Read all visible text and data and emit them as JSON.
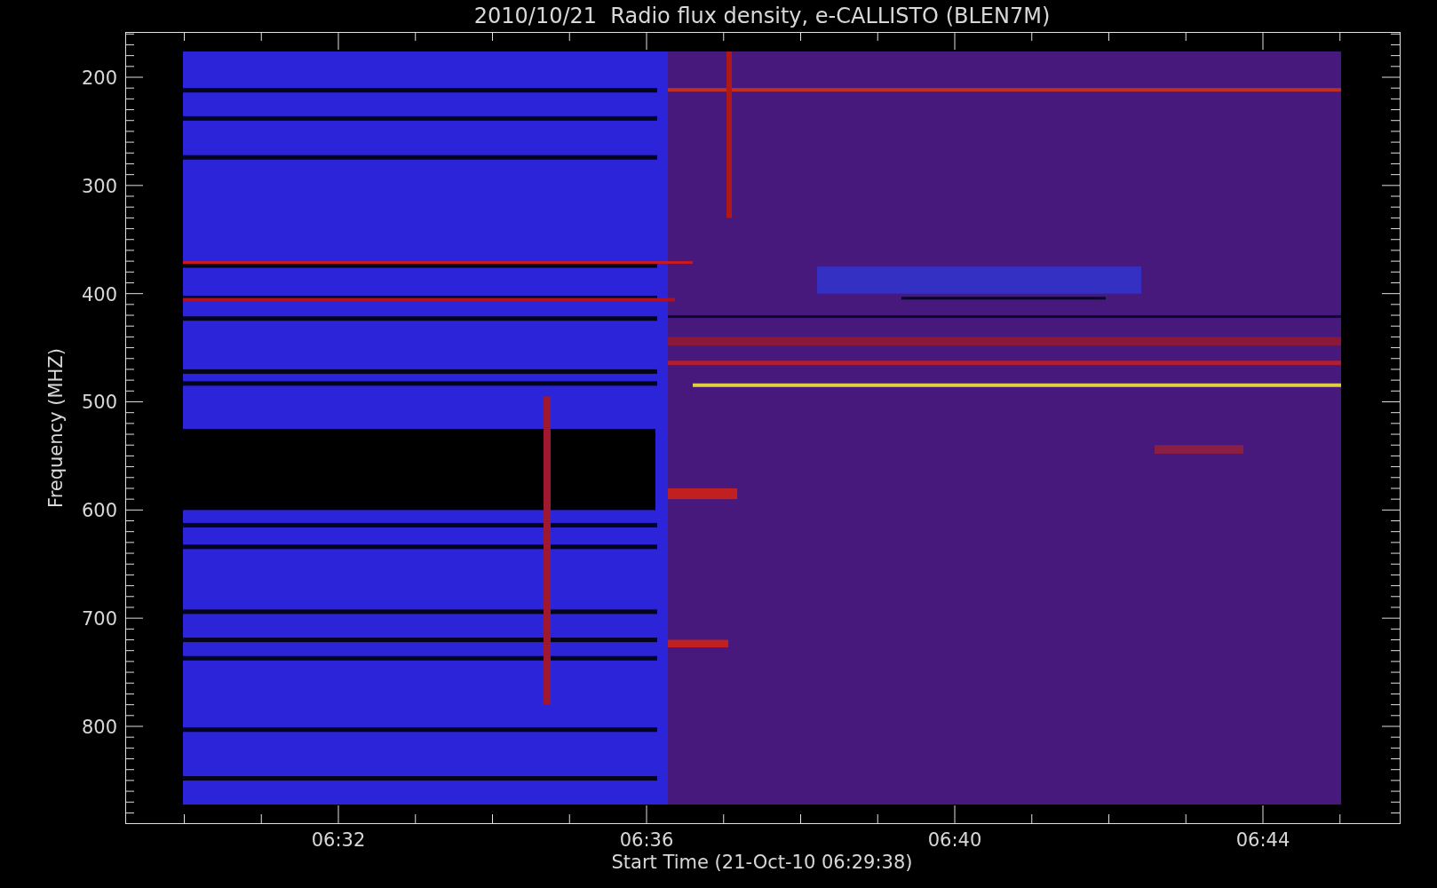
{
  "title": "2010/10/21  Radio flux density, e-CALLISTO (BLEN7M)",
  "ylabel": "Frequency (MHZ)",
  "xlabel": "Start Time (21-Oct-10 06:29:38)",
  "yticks": [
    "200",
    "300",
    "400",
    "500",
    "600",
    "700",
    "800"
  ],
  "xticks": [
    "06:32",
    "06:36",
    "06:40",
    "06:44"
  ]
}
